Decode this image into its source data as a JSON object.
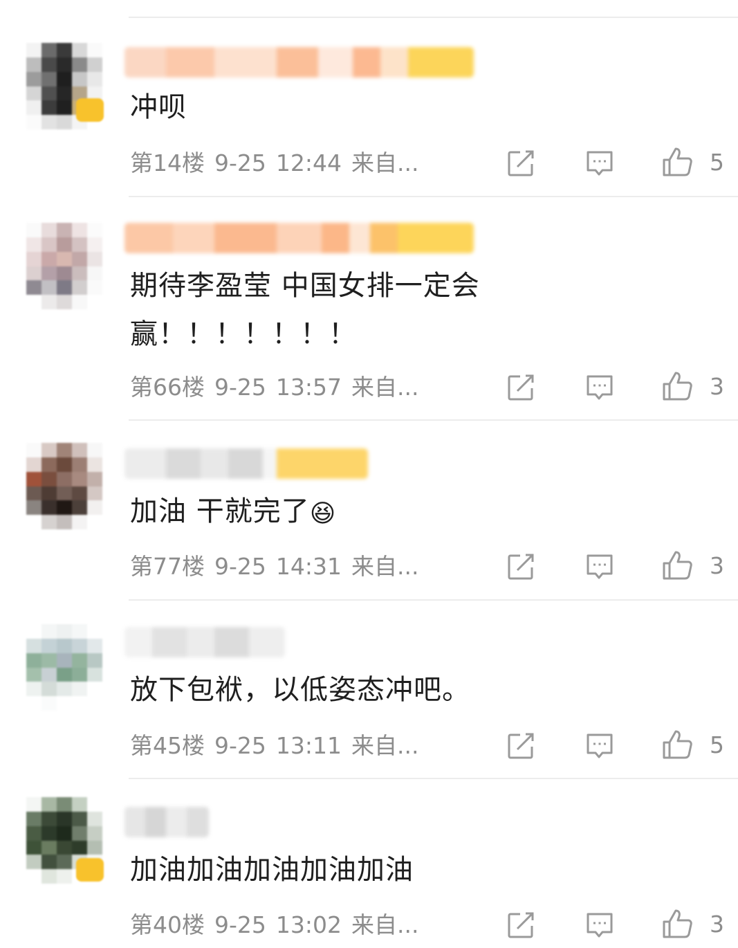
{
  "colors": {
    "meta_gray": "#8c8c8c",
    "icon_gray": "#9a9a9a",
    "divider": "#ececec",
    "vip_yellow": "#f8c22c"
  },
  "icons": {
    "repost": "repost-icon",
    "reply": "comment-icon",
    "like": "thumbs-up-icon"
  },
  "comments": [
    {
      "text_lines": [
        "冲呗"
      ],
      "floor": "第14楼",
      "date": "9-25",
      "time": "12:44",
      "source": "来自...",
      "likes": "5"
    },
    {
      "text_lines": [
        "期待李盈莹 中国女排一定会",
        "赢！！！！！！！"
      ],
      "floor": "第66楼",
      "date": "9-25",
      "time": "13:57",
      "source": "来自...",
      "likes": "3"
    },
    {
      "text_lines": [
        "加油 干就完了"
      ],
      "emoji": "😆",
      "floor": "第77楼",
      "date": "9-25",
      "time": "14:31",
      "source": "来自...",
      "likes": "3"
    },
    {
      "text_lines": [
        "放下包袱，以低姿态冲吧。"
      ],
      "floor": "第45楼",
      "date": "9-25",
      "time": "13:11",
      "source": "来自...",
      "likes": "5"
    },
    {
      "text_lines": [
        "加油加油加油加油加油"
      ],
      "floor": "第40楼",
      "date": "9-25",
      "time": "13:02",
      "source": "来自...",
      "likes": "3"
    }
  ]
}
